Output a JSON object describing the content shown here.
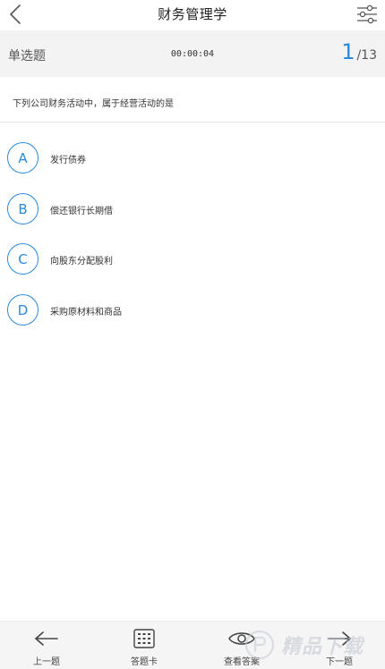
{
  "header": {
    "title": "财务管理学",
    "back_icon": "chevron-left-icon",
    "settings_icon": "sliders-icon"
  },
  "info": {
    "question_type": "单选题",
    "timer": "00:00:04",
    "current": "1",
    "total": "/13"
  },
  "question": {
    "text": "下列公司财务活动中，属于经营活动的是"
  },
  "options": [
    {
      "letter": "A",
      "text": "发行债券"
    },
    {
      "letter": "B",
      "text": "偿还银行长期借"
    },
    {
      "letter": "C",
      "text": "向股东分配股利"
    },
    {
      "letter": "D",
      "text": "采购原材料和商品"
    }
  ],
  "bottom_nav": {
    "prev": "上一题",
    "card": "答题卡",
    "answer": "查看答案",
    "next": "下一题"
  },
  "watermark": {
    "text": "精品下载"
  },
  "colors": {
    "accent": "#2a89d8",
    "infobar_bg": "#f3f3f3",
    "bottombar_bg": "#f5f5f5"
  }
}
